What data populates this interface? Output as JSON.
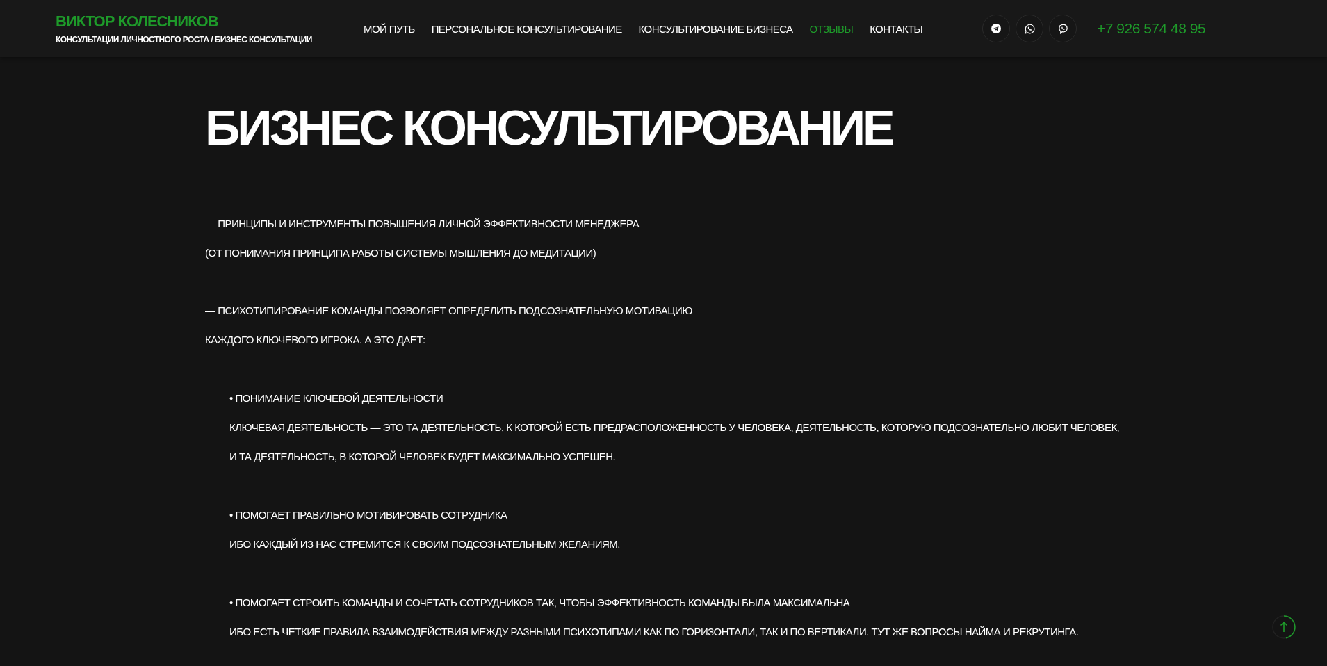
{
  "header": {
    "name": "ВИКТОР КОЛЕСНИКОВ",
    "tagline": "КОНСУЛЬТАЦИИ ЛИЧНОСТНОГО РОСТА / БИЗНЕС КОНСУЛЬТАЦИИ",
    "nav": [
      {
        "label": "МОЙ ПУТЬ",
        "selected": false
      },
      {
        "label": "ПЕРСОНАЛЬНОЕ КОНСУЛЬТИРОВАНИЕ",
        "selected": false
      },
      {
        "label": "КОНСУЛЬТИРОВАНИЕ БИЗНЕСА",
        "selected": false
      },
      {
        "label": "ОТЗЫВЫ",
        "selected": true
      },
      {
        "label": "КОНТАКТЫ",
        "selected": false
      }
    ],
    "social": [
      {
        "kind": "telegram"
      },
      {
        "kind": "whatsapp"
      },
      {
        "kind": "viber"
      }
    ],
    "phone": "+7 926 574 48 95"
  },
  "page_title": "БИЗНЕС КОНСУЛЬТИРОВАНИЕ",
  "sections": [
    {
      "lines": [
        "— ПРИНЦИПЫ И ИНСТРУМЕНТЫ ПОВЫШЕНИЯ ЛИЧНОЙ ЭФФЕКТИВНОСТИ МЕНЕДЖЕРА",
        "(ОТ ПОНИМАНИЯ ПРИНЦИПА РАБОТЫ СИСТЕМЫ МЫШЛЕНИЯ ДО МЕДИТАЦИИ)"
      ]
    },
    {
      "lines": [
        "— ПСИХОТИПИРОВАНИЕ КОМАНДЫ ПОЗВОЛЯЕТ ОПРЕДЕЛИТЬ ПОДСОЗНАТЕЛЬНУЮ МОТИВАЦИЮ",
        "КАЖДОГО КЛЮЧЕВОГО ИГРОКА. А ЭТО ДАЕТ:"
      ],
      "points": [
        {
          "title": "• ПОНИМАНИЕ КЛЮЧЕВОЙ ДЕЯТЕЛЬНОСТИ",
          "text": "КЛЮЧЕВАЯ ДЕЯТЕЛЬНОСТЬ — ЭТО ТА ДЕЯТЕЛЬНОСТЬ, К КОТОРОЙ ЕСТЬ ПРЕДРАСПОЛОЖЕННОСТЬ У ЧЕЛОВЕКА, ДЕЯТЕЛЬНОСТЬ, КОТОРУЮ ПОДСОЗНАТЕЛЬНО ЛЮБИТ ЧЕЛОВЕК, И ТА ДЕЯТЕЛЬНОСТЬ, В КОТОРОЙ ЧЕЛОВЕК БУДЕТ МАКСИМАЛЬНО УСПЕШЕН."
        },
        {
          "title": "• ПОМОГАЕТ ПРАВИЛЬНО МОТИВИРОВАТЬ СОТРУДНИКА",
          "text": "ИБО КАЖДЫЙ ИЗ НАС СТРЕМИТСЯ К СВОИМ ПОДСОЗНАТЕЛЬНЫМ ЖЕЛАНИЯМ."
        },
        {
          "title": "• ПОМОГАЕТ СТРОИТЬ КОМАНДЫ И СОЧЕТАТЬ СОТРУДНИКОВ ТАК, ЧТОБЫ ЭФФЕКТИВНОСТЬ КОМАНДЫ БЫЛА МАКСИМАЛЬНА",
          "text": "ИБО ЕСТЬ ЧЕТКИЕ ПРАВИЛА ВЗАИМОДЕЙСТВИЯ МЕЖДУ РАЗНЫМИ ПСИХОТИПАМИ КАК ПО ГОРИЗОНТАЛИ, ТАК И ПО ВЕРТИКАЛИ. ТУТ ЖЕ ВОПРОСЫ НАЙМА И РЕКРУТИНГА."
        }
      ]
    }
  ]
}
